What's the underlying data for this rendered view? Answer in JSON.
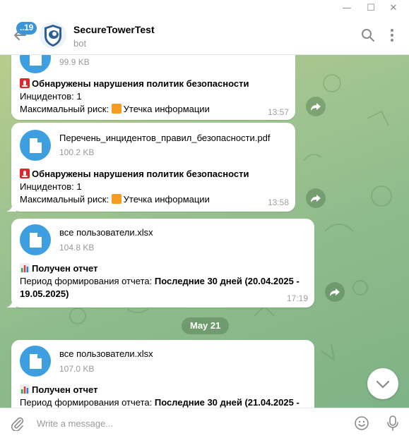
{
  "window": {
    "minimize_glyph": "—",
    "maximize_glyph": "☐",
    "close_glyph": "✕"
  },
  "header": {
    "unread_count": "..19",
    "title": "SecureTowerTest",
    "subtitle": "bot",
    "icons": [
      "back-arrow-icon",
      "search-icon",
      "more-vertical-icon"
    ]
  },
  "messages": [
    {
      "file_size": "99.9 KB",
      "line1": "Обнаружены нарушения политик безопасности",
      "line2": "Инцидентов: 1",
      "line3_prefix": "Максимальный риск: ",
      "line3_value": "Утечка информации",
      "time": "13:57",
      "icons": [
        "siren-emoji",
        "orange-square-emoji",
        "file-icon",
        "forward-icon"
      ]
    },
    {
      "file_name": "Перечень_инцидентов_правил_безопасности.pdf",
      "file_size": "100.2 KB",
      "line1": "Обнаружены нарушения политик безопасности",
      "line2": "Инцидентов: 1",
      "line3_prefix": "Максимальный риск: ",
      "line3_value": "Утечка информации",
      "time": "13:58"
    },
    {
      "file_name": "все пользователи.xlsx",
      "file_size": "104.8 KB",
      "line1": "Получен отчет",
      "line2_prefix": "Период формирования отчета: ",
      "line2_bold": "Последние 30 дней (20.04.2025 -",
      "line3_bold": "19.05.2025)",
      "time": "17:19",
      "icons": [
        "bar-chart-emoji"
      ]
    },
    {
      "file_name": "все пользователи.xlsx",
      "file_size": "107.0 KB",
      "line1": "Получен отчет",
      "line2_prefix": "Период формирования отчета: ",
      "line2_bold": "Последние 30 дней (21.04.2025 -"
    }
  ],
  "date_separator": "May 21",
  "compose": {
    "placeholder": "Write a message...",
    "icons": [
      "paperclip-icon",
      "smiley-icon",
      "microphone-icon"
    ]
  },
  "colors": {
    "accent": "#3d9ee0",
    "badge": "#3a95d9",
    "chat_bg": "#9ec390",
    "siren": "#e0262b",
    "orange": "#f59a23",
    "chart_green": "#3fa34d",
    "chart_red": "#e03a3a",
    "chart_blue": "#2f7fd6"
  }
}
